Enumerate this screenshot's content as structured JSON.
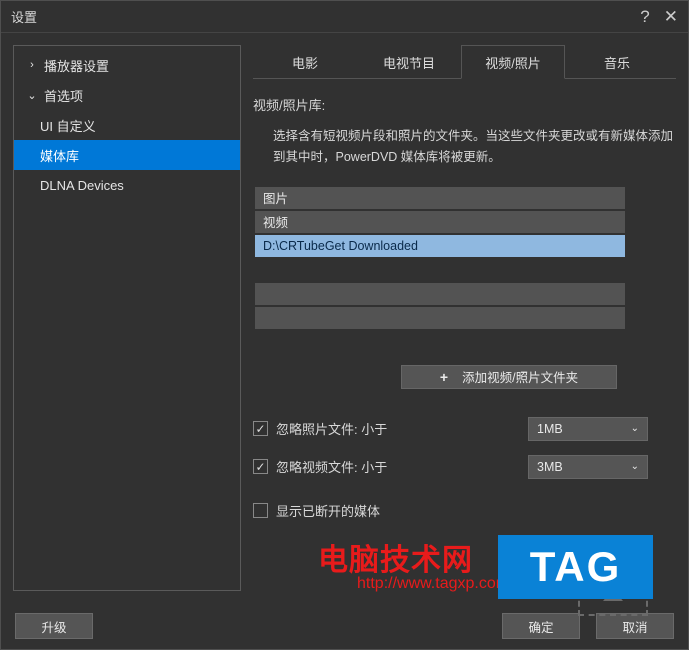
{
  "title": "设置",
  "sidebar": {
    "items": [
      {
        "label": "播放器设置",
        "expanded": false,
        "selected": false
      },
      {
        "label": "首选项",
        "expanded": true,
        "selected": false,
        "children": [
          {
            "label": "UI 自定义",
            "selected": false
          },
          {
            "label": "媒体库",
            "selected": true
          },
          {
            "label": "DLNA Devices",
            "selected": false
          }
        ]
      }
    ]
  },
  "tabs": {
    "items": [
      {
        "label": "电影",
        "active": false
      },
      {
        "label": "电视节目",
        "active": false
      },
      {
        "label": "视频/照片",
        "active": true
      },
      {
        "label": "音乐",
        "active": false
      }
    ]
  },
  "panel": {
    "section_label": "视频/照片库:",
    "description": "选择含有短视频片段和照片的文件夹。当这些文件夹更改或有新媒体添加到其中时，PowerDVD 媒体库将被更新。",
    "folders": [
      {
        "label": "图片",
        "selected": false
      },
      {
        "label": "视频",
        "selected": false
      },
      {
        "label": "D:\\CRTubeGet Downloaded",
        "selected": true
      }
    ],
    "add_button": "添加视频/照片文件夹",
    "options": {
      "ignore_photo": {
        "label": "忽略照片文件: 小于",
        "checked": true,
        "value": "1MB"
      },
      "ignore_video": {
        "label": "忽略视频文件: 小于",
        "checked": true,
        "value": "3MB"
      },
      "show_disconnected": {
        "label": "显示已断开的媒体",
        "checked": false
      }
    }
  },
  "footer": {
    "upgrade": "升级",
    "ok": "确定",
    "cancel": "取消"
  },
  "watermark": {
    "text1": "电脑技术网",
    "text2": "http://www.tagxp.com",
    "tag": "TAG"
  }
}
